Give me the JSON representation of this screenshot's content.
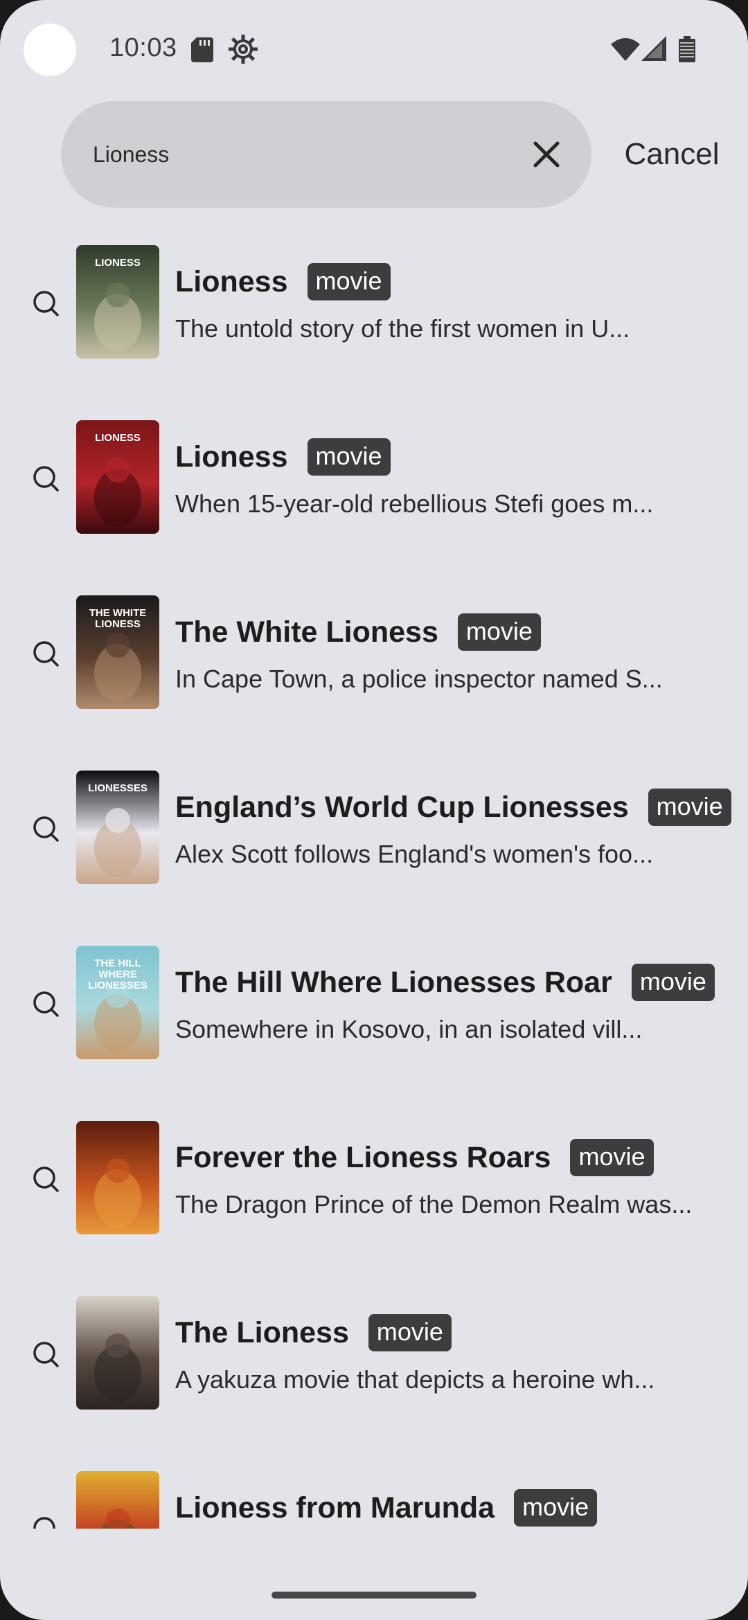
{
  "status_bar": {
    "time": "10:03",
    "icons": [
      "sd-card-icon",
      "settings-gear-icon",
      "wifi-icon",
      "cell-signal-icon",
      "battery-icon"
    ]
  },
  "search": {
    "query": "Lioness",
    "clear_icon": "close-icon",
    "cancel_label": "Cancel"
  },
  "results": [
    {
      "title": "Lioness",
      "type": "movie",
      "description": "The untold story of the first women in U...",
      "poster_text": "LIONESS",
      "poster_colors": [
        "#2f3b2a",
        "#6b7a5a",
        "#c9c2a8"
      ]
    },
    {
      "title": "Lioness",
      "type": "movie",
      "description": "When 15-year-old rebellious Stefi goes m...",
      "poster_text": "LIONESS",
      "poster_colors": [
        "#7a1518",
        "#b2242a",
        "#3a0a0c"
      ]
    },
    {
      "title": "The White Lioness",
      "type": "movie",
      "description": "In Cape Town, a police inspector named S...",
      "poster_text": "THE WHITE LIONESS",
      "poster_colors": [
        "#1a1a1a",
        "#5a3f30",
        "#b08a6a"
      ]
    },
    {
      "title": "England’s World Cup Lionesses",
      "type": "movie",
      "description": "Alex Scott follows England's women's foo...",
      "poster_text": "LIONESSES",
      "poster_colors": [
        "#0d0d14",
        "#e8e8ee",
        "#c8a58a"
      ]
    },
    {
      "title": "The Hill Where Lionesses Roar",
      "type": "movie",
      "description": "Somewhere in Kosovo, in an isolated vill...",
      "poster_text": "THE HILL WHERE LIONESSES ROAR",
      "poster_colors": [
        "#7fc3d0",
        "#a9d8de",
        "#c99a6a"
      ]
    },
    {
      "title": "Forever the Lioness Roars",
      "type": "movie",
      "description": "The Dragon Prince of the Demon Realm was...",
      "poster_text": "",
      "poster_colors": [
        "#5a1e0e",
        "#c4521e",
        "#e89a3a"
      ]
    },
    {
      "title": "The Lioness",
      "type": "movie",
      "description": "A yakuza movie that depicts a heroine wh...",
      "poster_text": "",
      "poster_colors": [
        "#d8d2c8",
        "#5a4a44",
        "#2a2420"
      ]
    },
    {
      "title": "Lioness from Marunda",
      "type": "movie",
      "description": "",
      "poster_text": "",
      "poster_colors": [
        "#e0b030",
        "#c23a20",
        "#2a5a2a"
      ]
    }
  ],
  "row_icon": "search-icon",
  "colors": {
    "background": "#e2e4ea",
    "search_field": "#cfd0d4",
    "badge": "#3d3d3d",
    "text": "#1d1d1d"
  }
}
